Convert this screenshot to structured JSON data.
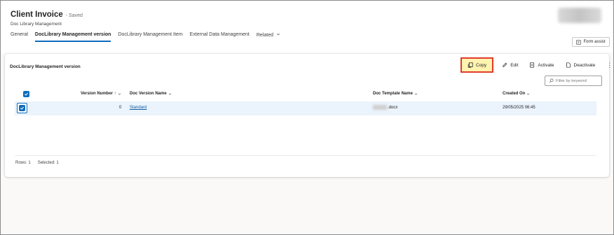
{
  "header": {
    "title": "Client Invoice",
    "saved_status": "- Saved",
    "subtitle": "Doc Library Management"
  },
  "tabs": [
    {
      "label": "General"
    },
    {
      "label": "DocLibrary Management version"
    },
    {
      "label": "DocLibrary Management Item"
    },
    {
      "label": "External Data Management"
    },
    {
      "label": "Related"
    }
  ],
  "form_assist_label": "Form assist",
  "subgrid": {
    "title": "DocLibrary Management version",
    "commands": {
      "copy": "Copy",
      "edit": "Edit",
      "activate": "Activate",
      "deactivate": "Deactivate"
    },
    "filter_placeholder": "Filter by keyword",
    "columns": {
      "version_number": "Version Number ↑",
      "doc_version_name": "Doc Version Name",
      "doc_template_name": "Doc Template Name",
      "created_on": "Created On"
    },
    "rows": [
      {
        "version_number": "0",
        "doc_version_name": "Standard",
        "doc_template_name_suffix": ".docx",
        "created_on": "29/05/2025 06:45"
      }
    ],
    "footer": {
      "rows": "Rows: 1",
      "selected": "Selected: 1"
    }
  },
  "colors": {
    "accent": "#0f6cbd",
    "copy_highlight": "#fff3b0",
    "copy_border": "#e23a2a",
    "selected_row": "#ebf3fc"
  },
  "icons": [
    "copy-icon",
    "edit-icon",
    "activate-icon",
    "deactivate-icon",
    "more-icon",
    "search-icon",
    "checkmark-icon",
    "chevron-down-icon",
    "form-assist-icon"
  ]
}
